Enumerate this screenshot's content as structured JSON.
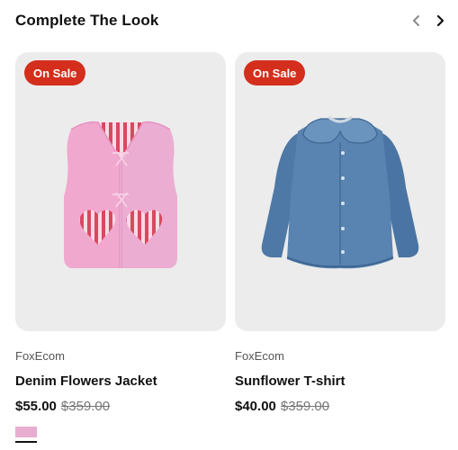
{
  "section": {
    "title": "Complete The Look"
  },
  "products": [
    {
      "badge": "On Sale",
      "vendor": "FoxEcom",
      "name": "Denim Flowers Jacket",
      "price": "$55.00",
      "compare_price": "$359.00",
      "swatches": [
        {
          "color": "#e8aed0"
        }
      ]
    },
    {
      "badge": "On Sale",
      "vendor": "FoxEcom",
      "name": "Sunflower T-shirt",
      "price": "$40.00",
      "compare_price": "$359.00",
      "swatches": []
    }
  ],
  "colors": {
    "badge_bg": "#d32f1c",
    "card_bg": "#ececec"
  },
  "icons": {
    "prev": "chevron-left-icon",
    "next": "chevron-right-icon"
  }
}
